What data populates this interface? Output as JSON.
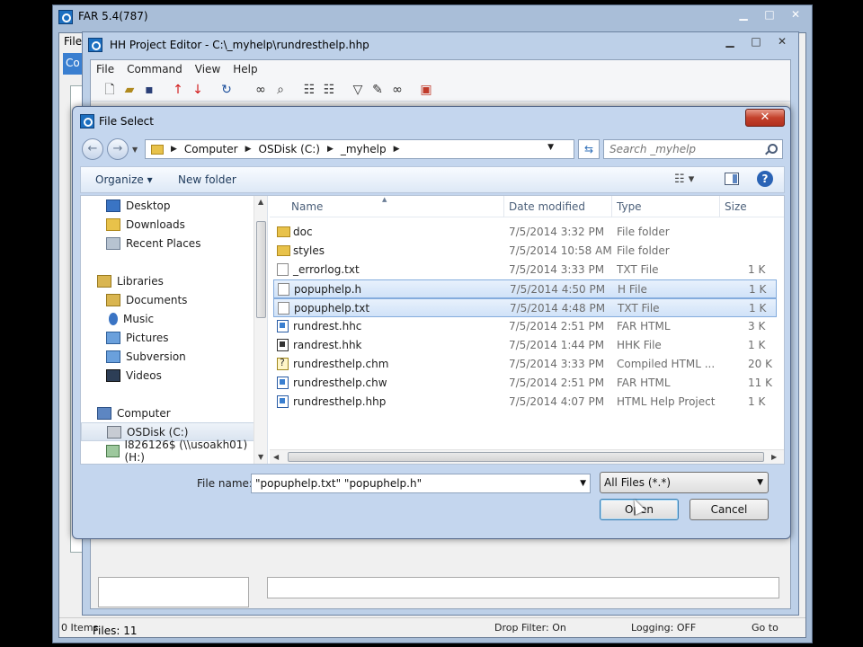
{
  "far": {
    "title": "FAR 5.4(787)",
    "menu_fragment": "File",
    "tab_fragment": "Co",
    "status_items": "0 Items",
    "drop_filter": "Drop Filter: On",
    "logging": "Logging: OFF",
    "goto": "Go to"
  },
  "hh": {
    "title": "HH Project Editor - C:\\_myhelp\\rundresthelp.hhp",
    "menu": [
      "File",
      "Command",
      "View",
      "Help"
    ],
    "files_count": "Files: 11"
  },
  "dialog": {
    "title": "File Select",
    "address": [
      "Computer",
      "OSDisk (C:)",
      "_myhelp"
    ],
    "search_placeholder": "Search _myhelp",
    "organize": "Organize ▾",
    "new_folder": "New folder",
    "nav": [
      {
        "label": "Desktop",
        "icon": "desktop-icon"
      },
      {
        "label": "Downloads",
        "icon": "downloads-folder-icon"
      },
      {
        "label": "Recent Places",
        "icon": "recent-places-icon"
      },
      {
        "label": "Libraries",
        "icon": "libraries-icon"
      },
      {
        "label": "Documents",
        "icon": "documents-icon"
      },
      {
        "label": "Music",
        "icon": "music-icon"
      },
      {
        "label": "Pictures",
        "icon": "pictures-icon"
      },
      {
        "label": "Subversion",
        "icon": "subversion-icon"
      },
      {
        "label": "Videos",
        "icon": "videos-icon"
      },
      {
        "label": "Computer",
        "icon": "computer-icon"
      },
      {
        "label": "OSDisk (C:)",
        "icon": "disk-icon"
      },
      {
        "label": "I826126$ (\\\\usoakh01) (H:)",
        "icon": "network-drive-icon"
      }
    ],
    "columns": [
      "Name",
      "Date modified",
      "Type",
      "Size"
    ],
    "files": [
      {
        "name": "doc",
        "date": "7/5/2014 3:32 PM",
        "type": "File folder",
        "size": "",
        "icon": "folder"
      },
      {
        "name": "styles",
        "date": "7/5/2014 10:58 AM",
        "type": "File folder",
        "size": "",
        "icon": "folder"
      },
      {
        "name": "_errorlog.txt",
        "date": "7/5/2014 3:33 PM",
        "type": "TXT File",
        "size": "1 K",
        "icon": "txt"
      },
      {
        "name": "popuphelp.h",
        "date": "7/5/2014 4:50 PM",
        "type": "H File",
        "size": "1 K",
        "icon": "txt"
      },
      {
        "name": "popuphelp.txt",
        "date": "7/5/2014 4:48 PM",
        "type": "TXT File",
        "size": "1 K",
        "icon": "txt"
      },
      {
        "name": "rundrest.hhc",
        "date": "7/5/2014 2:51 PM",
        "type": "FAR HTML",
        "size": "3 K",
        "icon": "html"
      },
      {
        "name": "randrest.hhk",
        "date": "7/5/2014 1:44 PM",
        "type": "HHK File",
        "size": "1 K",
        "icon": "hhk"
      },
      {
        "name": "rundresthelp.chm",
        "date": "7/5/2014 3:33 PM",
        "type": "Compiled HTML ...",
        "size": "20 K",
        "icon": "chm"
      },
      {
        "name": "rundresthelp.chw",
        "date": "7/5/2014 2:51 PM",
        "type": "FAR HTML",
        "size": "11 K",
        "icon": "html"
      },
      {
        "name": "rundresthelp.hhp",
        "date": "7/5/2014 4:07 PM",
        "type": "HTML Help Project",
        "size": "1 K",
        "icon": "html"
      }
    ],
    "file_name_label": "File name:",
    "file_name_value": "\"popuphelp.txt\" \"popuphelp.h\"",
    "file_type": "All Files (*.*)",
    "open_label": "Open",
    "cancel_label": "Cancel"
  }
}
